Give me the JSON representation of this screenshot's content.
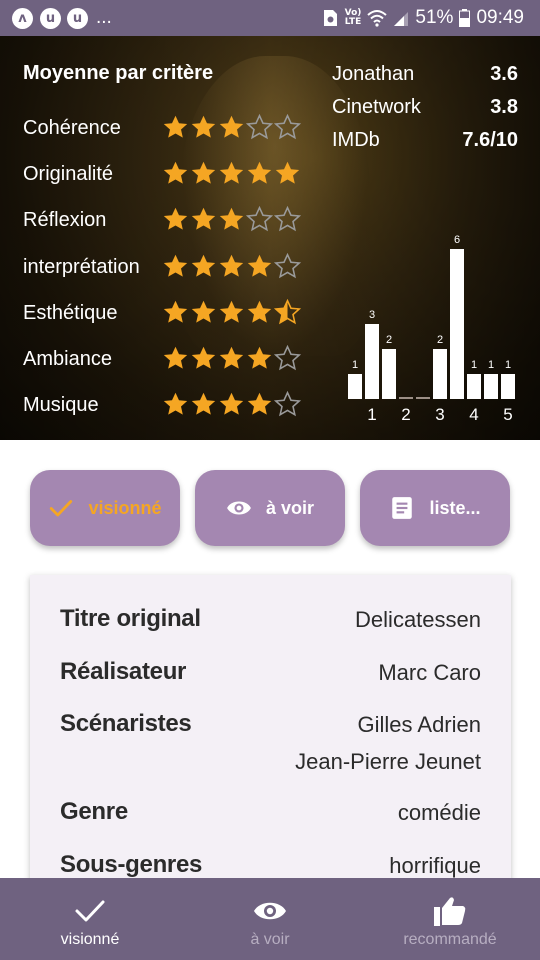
{
  "status_bar": {
    "app_icons": [
      "ʌ",
      "u",
      "u"
    ],
    "overflow": "...",
    "volte": "Vo)\nLTE",
    "battery": "51%",
    "time": "09:49"
  },
  "ratings": {
    "title": "Moyenne par critère",
    "criteria": [
      {
        "label": "Cohérence",
        "stars": 3
      },
      {
        "label": "Originalité",
        "stars": 5
      },
      {
        "label": "Réflexion",
        "stars": 3
      },
      {
        "label": "interprétation",
        "stars": 4
      },
      {
        "label": "Esthétique",
        "stars": 4.5
      },
      {
        "label": "Ambiance",
        "stars": 4
      },
      {
        "label": "Musique",
        "stars": 4
      }
    ],
    "star_color": "#f5a623"
  },
  "external_scores": [
    {
      "label": "Jonathan",
      "value": "3.6"
    },
    {
      "label": "Cinetwork",
      "value": "3.8"
    },
    {
      "label": "IMDb",
      "value": "7.6/10"
    }
  ],
  "chart_data": {
    "type": "bar",
    "title": "",
    "xlabel": "",
    "ylabel": "",
    "categories": [
      "0.5",
      "1",
      "1.5",
      "2",
      "2.5",
      "3",
      "3.5",
      "4",
      "4.5",
      "5"
    ],
    "x_tick_labels": [
      "1",
      "2",
      "3",
      "4",
      "5"
    ],
    "values": [
      1,
      3,
      2,
      0,
      0,
      2,
      6,
      1,
      1,
      1
    ],
    "ylim": [
      0,
      6
    ],
    "grid": false,
    "bar_color": "#ffffff"
  },
  "actions": [
    {
      "label": "visionné",
      "icon": "check-icon",
      "checked": true
    },
    {
      "label": "à voir",
      "icon": "eye-icon",
      "checked": false
    },
    {
      "label": "liste...",
      "icon": "list-icon",
      "checked": false
    }
  ],
  "details": {
    "original_title_label": "Titre original",
    "original_title": "Delicatessen",
    "director_label": "Réalisateur",
    "director": "Marc Caro",
    "writers_label": "Scénaristes",
    "writers": [
      "Gilles Adrien",
      "Jean-Pierre Jeunet"
    ],
    "genre_label": "Genre",
    "genre": "comédie",
    "subgenres_label": "Sous-genres",
    "subgenres": "horrifique"
  },
  "bottom_nav": [
    {
      "label": "visionné",
      "icon": "check-icon",
      "active": true
    },
    {
      "label": "à voir",
      "icon": "eye-icon",
      "active": false
    },
    {
      "label": "recommandé",
      "icon": "thumbs-up-icon",
      "active": false
    }
  ],
  "colors": {
    "primary": "#6f6280",
    "button": "#a487b1",
    "accent": "#f5a623"
  }
}
